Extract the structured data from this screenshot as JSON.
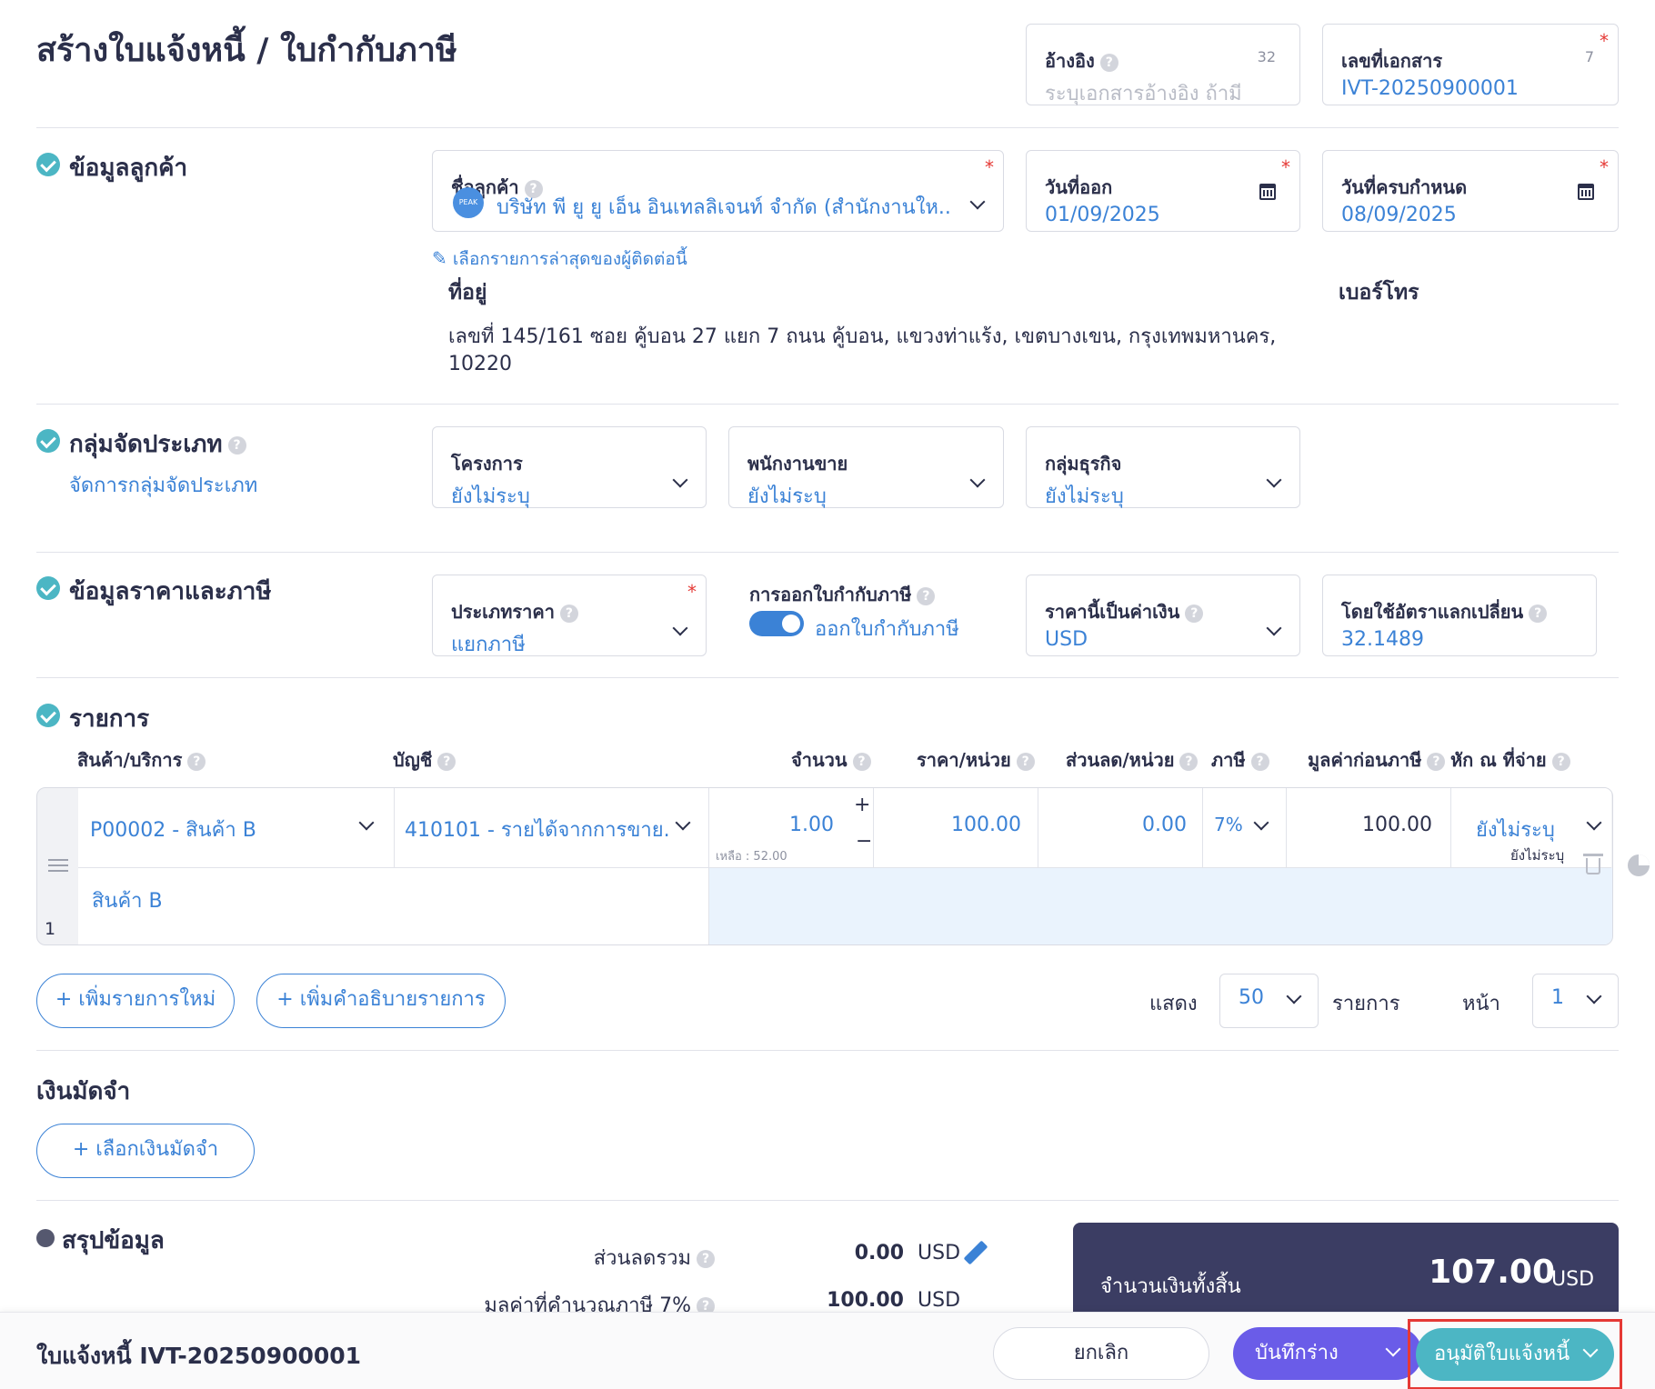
{
  "page": {
    "title": "สร้างใบแจ้งหนี้ / ใบกำกับภาษี"
  },
  "header": {
    "reference": {
      "label": "อ้างอิง",
      "count": "32",
      "placeholder": "ระบุเอกสารอ้างอิง ถ้ามี"
    },
    "doc_number": {
      "label": "เลขที่เอกสาร",
      "count": "7",
      "value": "IVT-20250900001"
    }
  },
  "customer": {
    "section": "ข้อมูลลูกค้า",
    "name_label": "ชื่อลูกค้า",
    "avatar_text": "PEAK",
    "name_value": "บริษัท พี ยู ยู เอ็น อินเทลลิเจนท์ จำกัด (สำนักงานให...",
    "issue_date_label": "วันที่ออก",
    "issue_date": "01/09/2025",
    "due_date_label": "วันที่ครบกำหนด",
    "due_date": "08/09/2025",
    "recent_link": "เลือกรายการล่าสุดของผู้ติดต่อนี้",
    "address_label": "ที่อยู่",
    "address_line1": "เลขที่ 145/161 ซอย คู้บอน 27 แยก 7 ถนน คู้บอน, แขวงท่าแร้ง, เขตบางเขน, กรุงเทพมหานคร,",
    "address_line2": "10220",
    "phone_label": "เบอร์โทร"
  },
  "classification": {
    "section": "กลุ่มจัดประเภท",
    "manage_link": "จัดการกลุ่มจัดประเภท",
    "project_label": "โครงการ",
    "project_value": "ยังไม่ระบุ",
    "sales_label": "พนักงานขาย",
    "sales_value": "ยังไม่ระบุ",
    "business_label": "กลุ่มธุรกิจ",
    "business_value": "ยังไม่ระบุ"
  },
  "pricing": {
    "section": "ข้อมูลราคาและภาษี",
    "price_type_label": "ประเภทราคา",
    "price_type_value": "แยกภาษี",
    "tax_invoice_label": "การออกใบกำกับภาษี",
    "tax_invoice_toggle": "ออกใบกำกับภาษี",
    "currency_label": "ราคานี้เป็นค่าเงิน",
    "currency_value": "USD",
    "rate_label": "โดยใช้อัตราแลกเปลี่ยน",
    "rate_value": "32.1489"
  },
  "items": {
    "section": "รายการ",
    "columns": {
      "product": "สินค้า/บริการ",
      "account": "บัญชี",
      "qty": "จำนวน",
      "price": "ราคา/หน่วย",
      "discount": "ส่วนลด/หน่วย",
      "tax": "ภาษี",
      "pretax": "มูลค่าก่อนภาษี",
      "withholding": "หัก ณ ที่จ่าย"
    },
    "row": {
      "index": "1",
      "product": "P00002 - สินค้า B",
      "account": "410101 - รายได้จากการขาย...",
      "qty": "1.00",
      "remaining": "เหลือ : 52.00",
      "price": "100.00",
      "discount": "0.00",
      "tax": "7%",
      "pretax": "100.00",
      "withholding": "ยังไม่ระบุ",
      "withholding_sub": "ยังไม่ระบุ",
      "description": "สินค้า B"
    },
    "add_item": "+ เพิ่มรายการใหม่",
    "add_desc": "+ เพิ่มคำอธิบายรายการ",
    "show_label": "แสดง",
    "page_size": "50",
    "items_label": "รายการ",
    "page_label": "หน้า",
    "page_value": "1"
  },
  "deposit": {
    "section": "เงินมัดจำ",
    "select_button": "+ เลือกเงินมัดจำ"
  },
  "summary": {
    "section": "สรุปข้อมูล",
    "discount_label": "ส่วนลดรวม",
    "discount_value": "0.00",
    "taxable_label": "มูลค่าที่คำนวณภาษี 7%",
    "taxable_value": "100.00",
    "currency": "USD",
    "total_label": "จำนวนเงินทั้งสิ้น",
    "total_value": "107.00"
  },
  "footer": {
    "doc_title": "ใบแจ้งหนี้ IVT-20250900001",
    "cancel": "ยกเลิก",
    "save_draft": "บันทึกร่าง",
    "approve": "อนุมัติใบแจ้งหนี้"
  },
  "colors": {
    "accent": "#3b82d6",
    "teal": "#4cb6c4",
    "purple": "#6a5ce8",
    "navy": "#3b3d63",
    "highlight": "#e53935"
  }
}
